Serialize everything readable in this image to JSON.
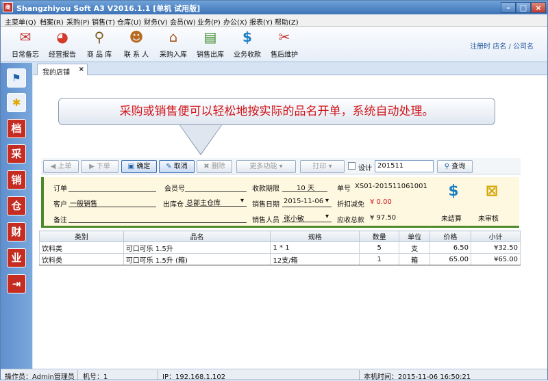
{
  "window": {
    "title": "Shangzhiyou Soft A3 V2016.1.1 [单机 试用版]",
    "app_icon": "商"
  },
  "menu": [
    "主菜单(Q)",
    "档案(R)",
    "采购(P)",
    "销售(T)",
    "仓库(U)",
    "财务(V)",
    "会员(W)",
    "业务(P)",
    "办公(X)",
    "报表(Y)",
    "帮助(Z)"
  ],
  "toolbar": [
    {
      "label": "日常备忘",
      "icon": "envelope-icon"
    },
    {
      "label": "经营报告",
      "icon": "pie-chart-icon"
    },
    {
      "label": "商 品 库",
      "icon": "magnifier-icon"
    },
    {
      "label": "联 系 人",
      "icon": "person-icon"
    },
    {
      "label": "采购入库",
      "icon": "house-icon"
    },
    {
      "label": "销售出库",
      "icon": "money-icon"
    },
    {
      "label": "业务收款",
      "icon": "dollar-icon"
    },
    {
      "label": "售后维护",
      "icon": "tools-icon"
    }
  ],
  "register_info": "注册时 店名 / 公司名",
  "sidebar": [
    {
      "name": "flag-icon",
      "glyph": "⚑"
    },
    {
      "name": "lightbulb-icon",
      "glyph": "💡"
    },
    {
      "name": "seal-icon",
      "glyph": "档"
    },
    {
      "name": "seal-icon",
      "glyph": "采"
    },
    {
      "name": "seal-icon",
      "glyph": "销"
    },
    {
      "name": "seal-icon",
      "glyph": "仓"
    },
    {
      "name": "seal-icon",
      "glyph": "财"
    },
    {
      "name": "seal-icon",
      "glyph": "业"
    },
    {
      "name": "exit-icon",
      "glyph": "⇥"
    }
  ],
  "tab": {
    "label": "我的店铺",
    "close": "×"
  },
  "callout": "采购或销售便可以轻松地按实际的品名开单，系统自动处理。",
  "actions": {
    "prev": "◀ 上单",
    "next": "▶ 下单",
    "confirm": "确定",
    "cancel": "取消",
    "delete": "✖ 删除",
    "more": "更多功能 ▾",
    "print": "打印 ▾",
    "design": "设计",
    "search_value": "201511",
    "query": "查询"
  },
  "form": {
    "order_label": "订单",
    "order_value": "",
    "member_label": "会员号",
    "member_value": "",
    "period_label": "收款期限",
    "period_value": "10 天",
    "number_label": "单号",
    "number_value": "XS01-201511061001",
    "customer_label": "客户",
    "customer_value": "一般销售",
    "warehouse_label": "出库仓",
    "warehouse_value": "总部主仓库",
    "date_label": "销售日期",
    "date_value": "2015-11-06",
    "discount_label": "折扣减免",
    "discount_value": "¥ 0.00",
    "note_label": "备注",
    "note_value": "",
    "sales_label": "销售人员",
    "sales_value": "张小敏",
    "total_label": "应收总款",
    "total_value": "¥ 97.50",
    "unsettled_label": "未结算",
    "unaudited_label": "未审核"
  },
  "table": {
    "columns": [
      "类别",
      "品名",
      "规格",
      "数量",
      "单位",
      "价格",
      "小计"
    ],
    "rows": [
      [
        "饮料类",
        "可口可乐 1.5升",
        "1 * 1",
        "5",
        "支",
        "6.50",
        "¥32.50"
      ],
      [
        "饮料类",
        "可口可乐 1.5升 (箱)",
        "12支/箱",
        "1",
        "箱",
        "65.00",
        "¥65.00"
      ]
    ]
  },
  "status": {
    "operator": "操作员：Admin管理员",
    "machine": "机号：1",
    "ip": "IP：192.168.1.102",
    "time": "本机时间：2015-11-06 16:50:21"
  },
  "colors": {
    "accent": "#3d73b8",
    "callout_text": "#d0161b",
    "form_border": "#4d8a2a",
    "form_bg": "#fff8e0"
  }
}
